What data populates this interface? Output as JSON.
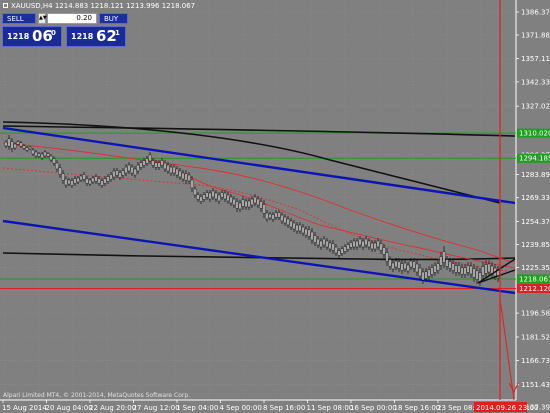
{
  "chart": {
    "title": "XAUUSD,H4  1214.883 1218.121 1213.996 1218.067",
    "copyright": "Alpari Limited MT4, © 2001-2014, MetaQuotes Software Corp.",
    "background": "#808080"
  },
  "trade_panel": {
    "sell_label": "SELL",
    "buy_label": "BUY",
    "lots": "0.20",
    "sell_quote_prefix": "1218",
    "sell_quote_big": "06",
    "sell_quote_sup": "0",
    "buy_quote_prefix": "1218",
    "buy_quote_big": "62",
    "buy_quote_sup": "1"
  },
  "price_axis": {
    "ticks": [
      "1386.370",
      "1371.880",
      "1357.110",
      "1342.330",
      "1327.020",
      "1296.370",
      "1283.890",
      "1269.330",
      "1254.370",
      "1239.850",
      "1225.350",
      "1196.580",
      "1181.520",
      "1166.730",
      "1151.430",
      "1137.390"
    ]
  },
  "time_axis": {
    "labels": [
      "15 Aug 2014",
      "20 Aug 04:00",
      "22 Aug 20:00",
      "27 Aug 12:00",
      "1 Sep 04:00",
      "4 Sep 00:00",
      "8 Sep 16:00",
      "11 Sep 08:00",
      "16 Sep 00:00",
      "18 Sep 16:00",
      "23 Sep 08:00"
    ],
    "current_label": "2014.09.26 23:00"
  },
  "levels": [
    {
      "price": "1310.020",
      "color": "#1e9e1e"
    },
    {
      "price": "1294.185",
      "color": "#1e9e1e"
    },
    {
      "price": "1218.067",
      "color": "#1e9e1e"
    },
    {
      "price": "1212.120",
      "color": "#e02020"
    }
  ],
  "colors": {
    "grid": "#8c8c8c",
    "channel": "#0a15b4",
    "ma": "#111111",
    "envelope": "#e03030",
    "candle": "#111111",
    "vertical": "#e02020"
  }
}
